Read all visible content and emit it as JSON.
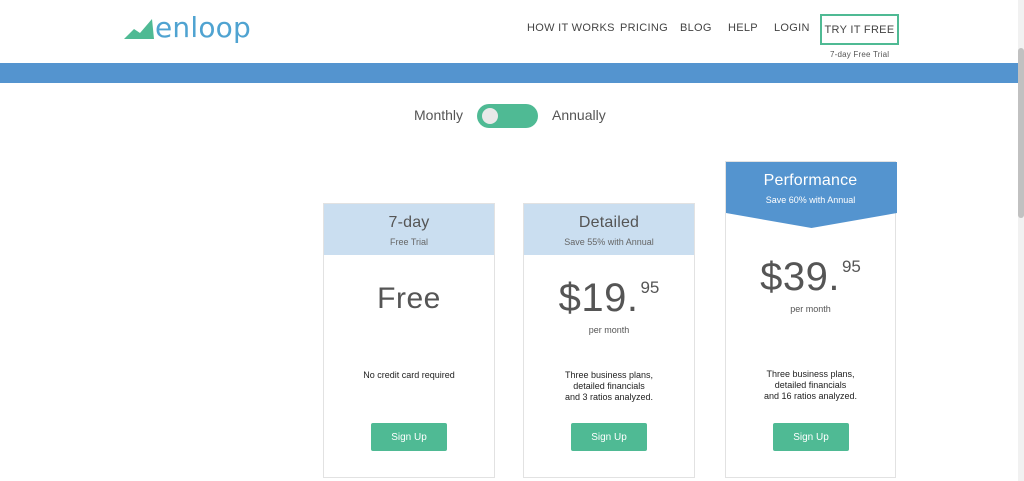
{
  "header": {
    "logo_text": "enloop",
    "nav": [
      "HOW IT WORKS",
      "PRICING",
      "BLOG",
      "HELP",
      "LOGIN"
    ],
    "cta_label": "TRY IT FREE",
    "cta_note": "7-day Free Trial"
  },
  "toggle": {
    "left_label": "Monthly",
    "right_label": "Annually",
    "state": "Monthly"
  },
  "plans": [
    {
      "name": "7-day",
      "subtitle": "Free Trial",
      "price": "Free",
      "description": [
        "No credit card required"
      ],
      "button": "Sign Up"
    },
    {
      "name": "Detailed",
      "subtitle": "Save 55% with Annual",
      "price_whole": "$19.",
      "price_cents": "95",
      "period": "per month",
      "description": [
        "Three business plans,",
        "detailed financials",
        "and 3 ratios analyzed."
      ],
      "button": "Sign Up"
    },
    {
      "name": "Performance",
      "subtitle": "Save 60% with Annual",
      "price_whole": "$39.",
      "price_cents": "95",
      "period": "per month",
      "description": [
        "Three business plans,",
        "detailed financials",
        "and 16 ratios analyzed."
      ],
      "button": "Sign Up"
    }
  ],
  "colors": {
    "brand_blue": "#5494cf",
    "accent_green": "#4fba94",
    "light_blue": "#cadef0",
    "logo_blue": "#4fa3d1"
  }
}
